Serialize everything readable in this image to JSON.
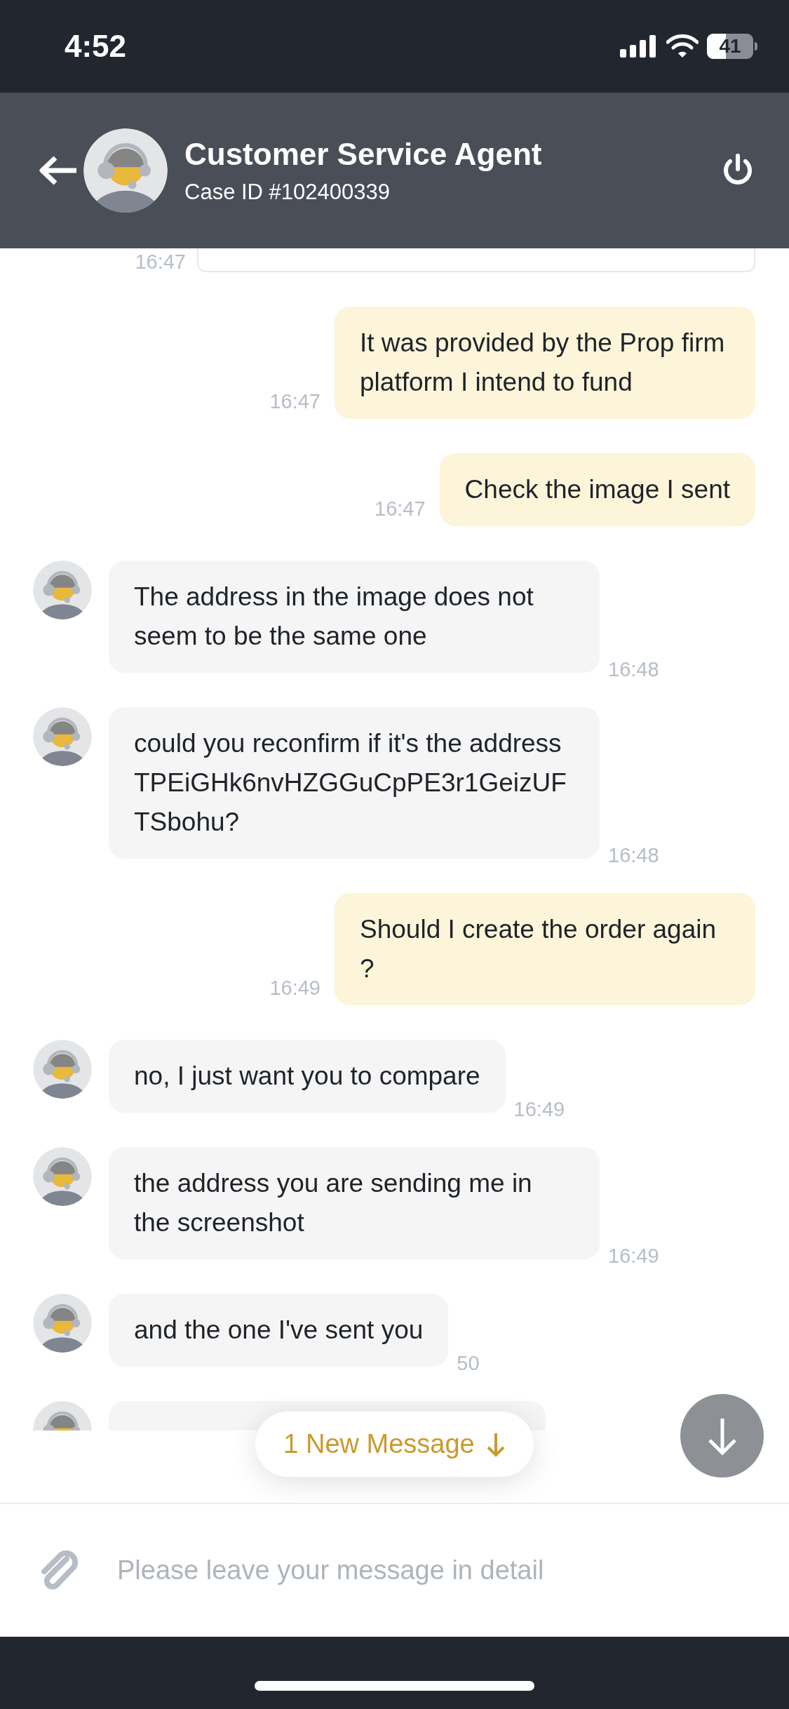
{
  "status_bar": {
    "time": "4:52",
    "battery": "41"
  },
  "header": {
    "title": "Customer Service Agent",
    "subtitle": "Case ID #102400339"
  },
  "messages": [
    {
      "kind": "sent_image",
      "time": "16:47"
    },
    {
      "kind": "sent",
      "text": "It was provided by the Prop firm platform I intend to fund",
      "time": "16:47"
    },
    {
      "kind": "sent",
      "text": "Check the image I sent",
      "time": "16:47"
    },
    {
      "kind": "received",
      "text": "The address in the image does not seem to be the same one",
      "time": "16:48"
    },
    {
      "kind": "received",
      "text": "could you reconfirm if it's the address TPEiGHk6nvHZGGuCpPE3r1GeizUFTSbohu?",
      "time": "16:48"
    },
    {
      "kind": "sent",
      "text": "Should I create the order again ?",
      "time": "16:49"
    },
    {
      "kind": "received",
      "text": "no, I just want you to compare",
      "time": "16:49"
    },
    {
      "kind": "received",
      "text": "the address you are sending me in the screenshot",
      "time": "16:49"
    },
    {
      "kind": "received",
      "text": "and the one I've sent you",
      "time": "50"
    },
    {
      "kind": "received_partial"
    }
  ],
  "new_message_pill": {
    "label": "1 New Message"
  },
  "input": {
    "placeholder": "Please leave your message in detail"
  }
}
